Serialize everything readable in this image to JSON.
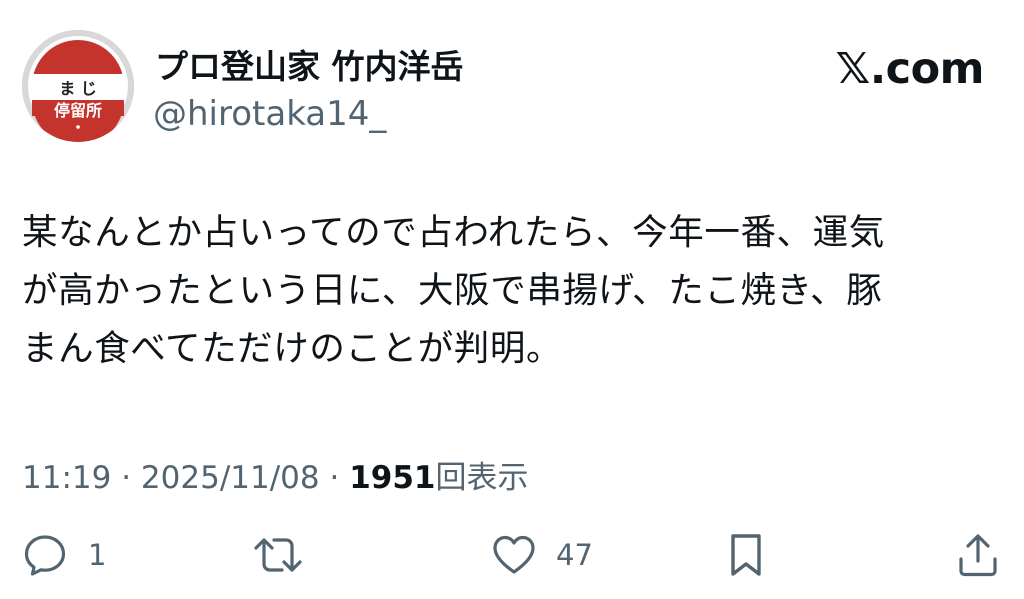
{
  "author": {
    "display_name": "プロ登山家 竹内洋岳",
    "handle": "@hirotaka14_",
    "avatar_icon": "bus-stop-sign-icon",
    "avatar_text_top": "ま じ",
    "avatar_text_bottom": "停留所"
  },
  "brand": {
    "label": "𝕏.com"
  },
  "tweet": {
    "lines": [
      "某なんとか占いってので占われたら、今年一番、運気",
      "が高かったという日に、大阪で串揚げ、たこ焼き、豚",
      "まん食べてただけのことが判明。"
    ]
  },
  "meta": {
    "time": "11:19",
    "separator": "·",
    "date": "2025/11/08",
    "views_count": "1951",
    "views_label": "回表示"
  },
  "actions": {
    "reply_count": "1",
    "retweet_count": "",
    "like_count": "47"
  },
  "colors": {
    "text": "#0f1419",
    "muted": "#536471",
    "avatar_red": "#c4342c"
  }
}
